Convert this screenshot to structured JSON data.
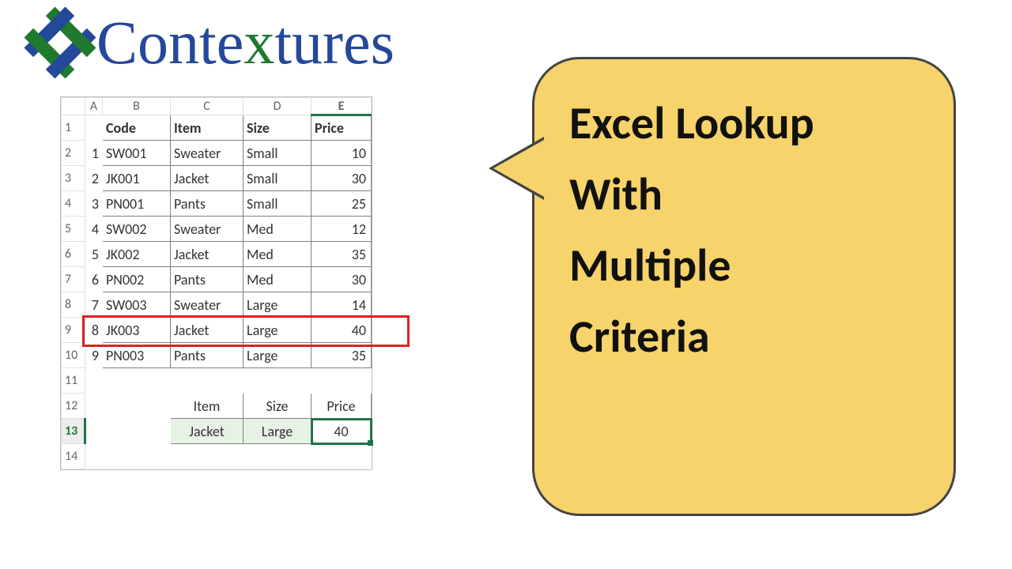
{
  "brand": {
    "name_pre": "Conte",
    "name_x": "x",
    "name_post": "tures"
  },
  "bubble": {
    "text": "Excel Lookup\nWith\nMultiple\nCriteria"
  },
  "col_heads": {
    "A": "A",
    "B": "B",
    "C": "C",
    "D": "D",
    "E": "E"
  },
  "row_heads": [
    "1",
    "2",
    "3",
    "4",
    "5",
    "6",
    "7",
    "8",
    "9",
    "10",
    "11",
    "12",
    "13",
    "14"
  ],
  "table": {
    "headers": {
      "code": "Code",
      "item": "Item",
      "size": "Size",
      "price": "Price"
    },
    "rows": [
      {
        "n": "1",
        "code": "SW001",
        "item": "Sweater",
        "size": "Small",
        "price": "10"
      },
      {
        "n": "2",
        "code": "JK001",
        "item": "Jacket",
        "size": "Small",
        "price": "30"
      },
      {
        "n": "3",
        "code": "PN001",
        "item": "Pants",
        "size": "Small",
        "price": "25"
      },
      {
        "n": "4",
        "code": "SW002",
        "item": "Sweater",
        "size": "Med",
        "price": "12"
      },
      {
        "n": "5",
        "code": "JK002",
        "item": "Jacket",
        "size": "Med",
        "price": "35"
      },
      {
        "n": "6",
        "code": "PN002",
        "item": "Pants",
        "size": "Med",
        "price": "30"
      },
      {
        "n": "7",
        "code": "SW003",
        "item": "Sweater",
        "size": "Large",
        "price": "14"
      },
      {
        "n": "8",
        "code": "JK003",
        "item": "Jacket",
        "size": "Large",
        "price": "40"
      },
      {
        "n": "9",
        "code": "PN003",
        "item": "Pants",
        "size": "Large",
        "price": "35"
      }
    ]
  },
  "lookup": {
    "headers": {
      "item": "Item",
      "size": "Size",
      "price": "Price"
    },
    "values": {
      "item": "Jacket",
      "size": "Large",
      "price": "40"
    }
  },
  "highlight": {
    "row_index": 8
  }
}
